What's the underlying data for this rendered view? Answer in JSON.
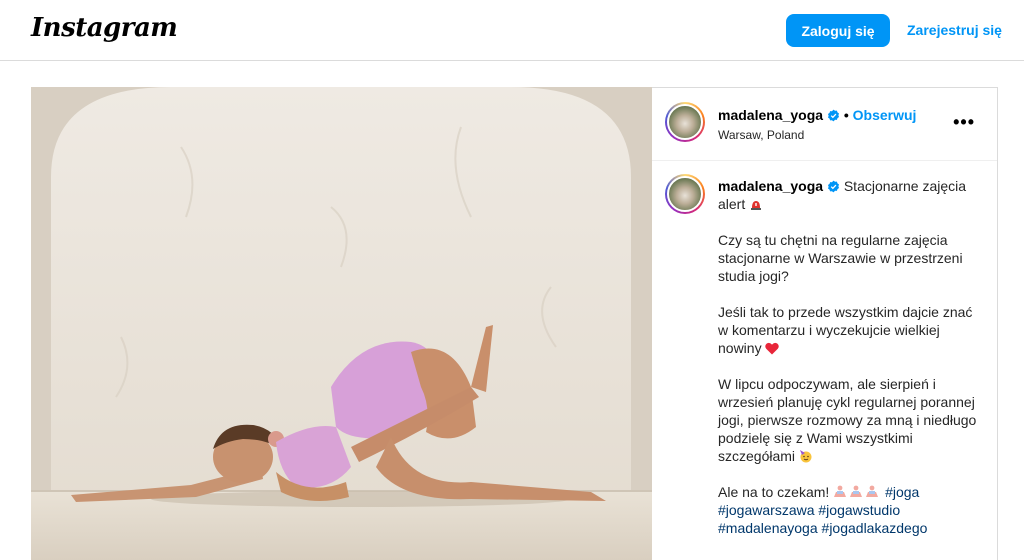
{
  "nav": {
    "logo": "Instagram",
    "login_label": "Zaloguj się",
    "signup_label": "Zarejestruj się"
  },
  "post": {
    "username": "madalena_yoga",
    "follow_label": "Obserwuj",
    "separator": "•",
    "location": "Warsaw, Poland",
    "more_label": "•••",
    "caption_line1": "Stacjonarne zajęcia alert",
    "caption_p2": "Czy są tu chętni na regularne zajęcia stacjonarne w Warszawie w przestrzeni studia jogi?",
    "caption_p3": "Jeśli tak to przede wszystkim dajcie znać w komentarzu i wyczekujcie wielkiej nowiny",
    "caption_p4": "W lipcu odpoczywam, ale sierpień i wrzesień planuję cykl regularnej porannej jogi, pierwsze rozmowy za mną i niedługo podzielę się z Wami wszystkimi szczegółami",
    "caption_p5": "Ale na to czekam!",
    "hashtags": [
      "#joga",
      "#jogawarszawa",
      "#jogawstudio",
      "#madalenayoga",
      "#jogadlakazdego"
    ]
  },
  "colors": {
    "accent": "#0095f6",
    "hashtag": "#00376b",
    "border": "#dbdbdb"
  },
  "icons": [
    "verified-badge-icon",
    "siren-icon",
    "heart-icon",
    "party-face-icon",
    "meditating-person-icon",
    "more-options-icon"
  ]
}
